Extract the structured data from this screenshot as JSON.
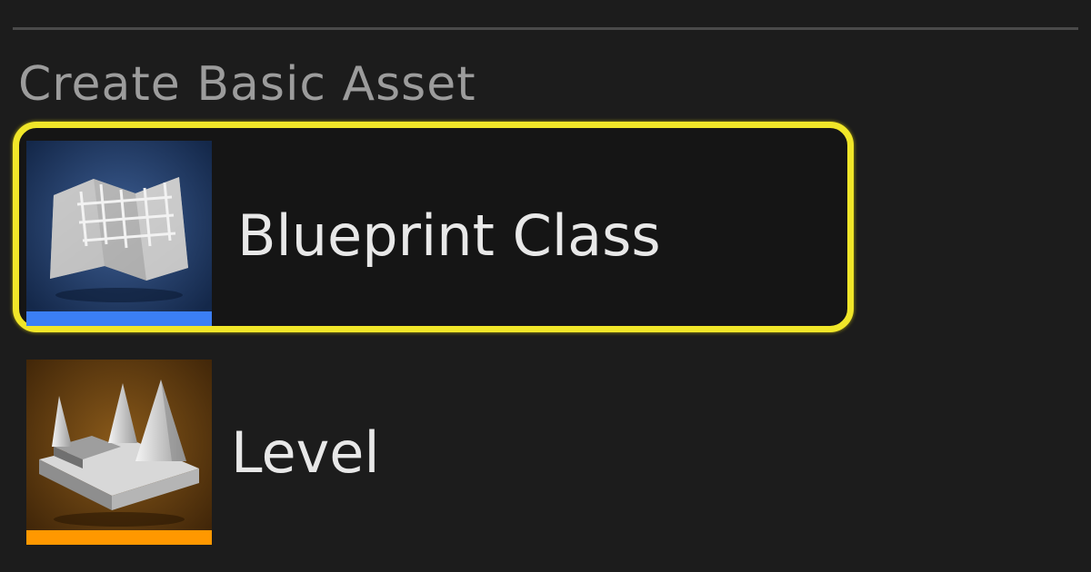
{
  "menu": {
    "section_title": "Create Basic Asset",
    "items": [
      {
        "label": "Blueprint Class",
        "icon": "blueprint-icon",
        "type_color": "#3b7ff5",
        "highlighted": true,
        "highlight_color": "#f0e629"
      },
      {
        "label": "Level",
        "icon": "level-icon",
        "type_color": "#ff9800",
        "highlighted": false
      }
    ]
  }
}
